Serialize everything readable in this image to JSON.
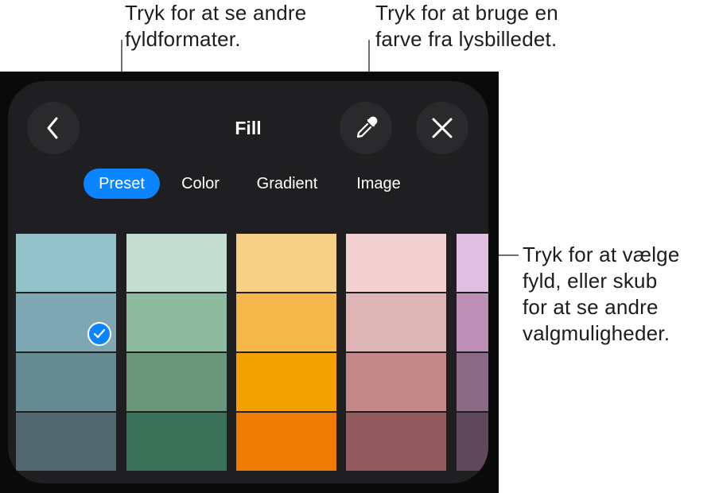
{
  "callouts": {
    "top_left": "Tryk for at se andre\nfyldformater.",
    "top_right": "Tryk for at bruge en\nfarve fra lysbilledet.",
    "right": "Tryk for at vælge\nfyld, eller skub\nfor at se andre\nvalgmuligheder."
  },
  "panel": {
    "title": "Fill",
    "icons": {
      "back": "chevron-left-icon",
      "eyedropper": "eyedropper-icon",
      "close": "close-icon",
      "selected": "checkmark-icon"
    },
    "tabs": [
      {
        "label": "Preset",
        "active": true
      },
      {
        "label": "Color",
        "active": false
      },
      {
        "label": "Gradient",
        "active": false
      },
      {
        "label": "Image",
        "active": false
      }
    ],
    "accent_color": "#0a84ff",
    "swatch_columns": [
      [
        "#94c1c7",
        "#7ea6b3",
        "#668a91",
        "#52686e"
      ],
      [
        "#c3ddd0",
        "#8ebaa0",
        "#6a9679",
        "#3a7257"
      ],
      [
        "#f6d087",
        "#f7b84b",
        "#f4a103",
        "#f07b02"
      ],
      [
        "#f2cfd0",
        "#dcb5b4",
        "#c48888",
        "#935b5e"
      ],
      [
        "#dfc0e0",
        "#be8fb5",
        "#8a6a84",
        "#5f475c"
      ]
    ],
    "selected_swatch": {
      "column": 0,
      "row": 1
    }
  }
}
